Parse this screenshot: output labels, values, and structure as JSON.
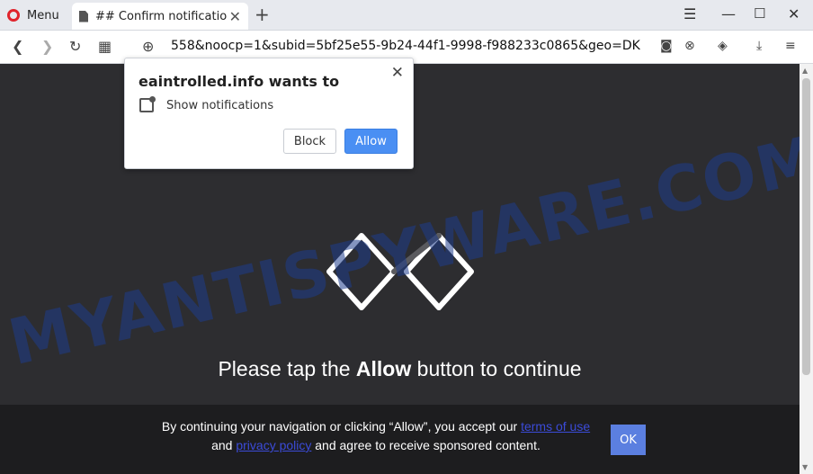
{
  "browser": {
    "menu_label": "Menu",
    "tab_title": "## Confirm notificatio",
    "tab_close": "✕",
    "new_tab": "+",
    "url": "558&noocp=1&subid=5bf25e55-9b24-44f1-9998-f988233c0865&geo=DK"
  },
  "popup": {
    "title": "eaintrolled.info wants to",
    "permission": "Show notifications",
    "block_label": "Block",
    "allow_label": "Allow",
    "close": "✕"
  },
  "page": {
    "headline_pre": "Please tap the ",
    "headline_bold": "Allow",
    "headline_post": " button to continue",
    "watermark": "MYANTISPYWARE.COM"
  },
  "consent": {
    "text_1": "By continuing your navigation or clicking “Allow”, you accept our ",
    "terms_link": "terms of use",
    "text_2": " and ",
    "privacy_link": "privacy policy",
    "text_3": " and agree to receive sponsored content.",
    "ok_label": "OK"
  },
  "colors": {
    "page_bg": "#2d2d30",
    "consent_bg": "#1d1d1f",
    "allow_blue": "#4a8ff3",
    "ok_blue": "#5b7fe0",
    "link": "#3b4bd8"
  }
}
